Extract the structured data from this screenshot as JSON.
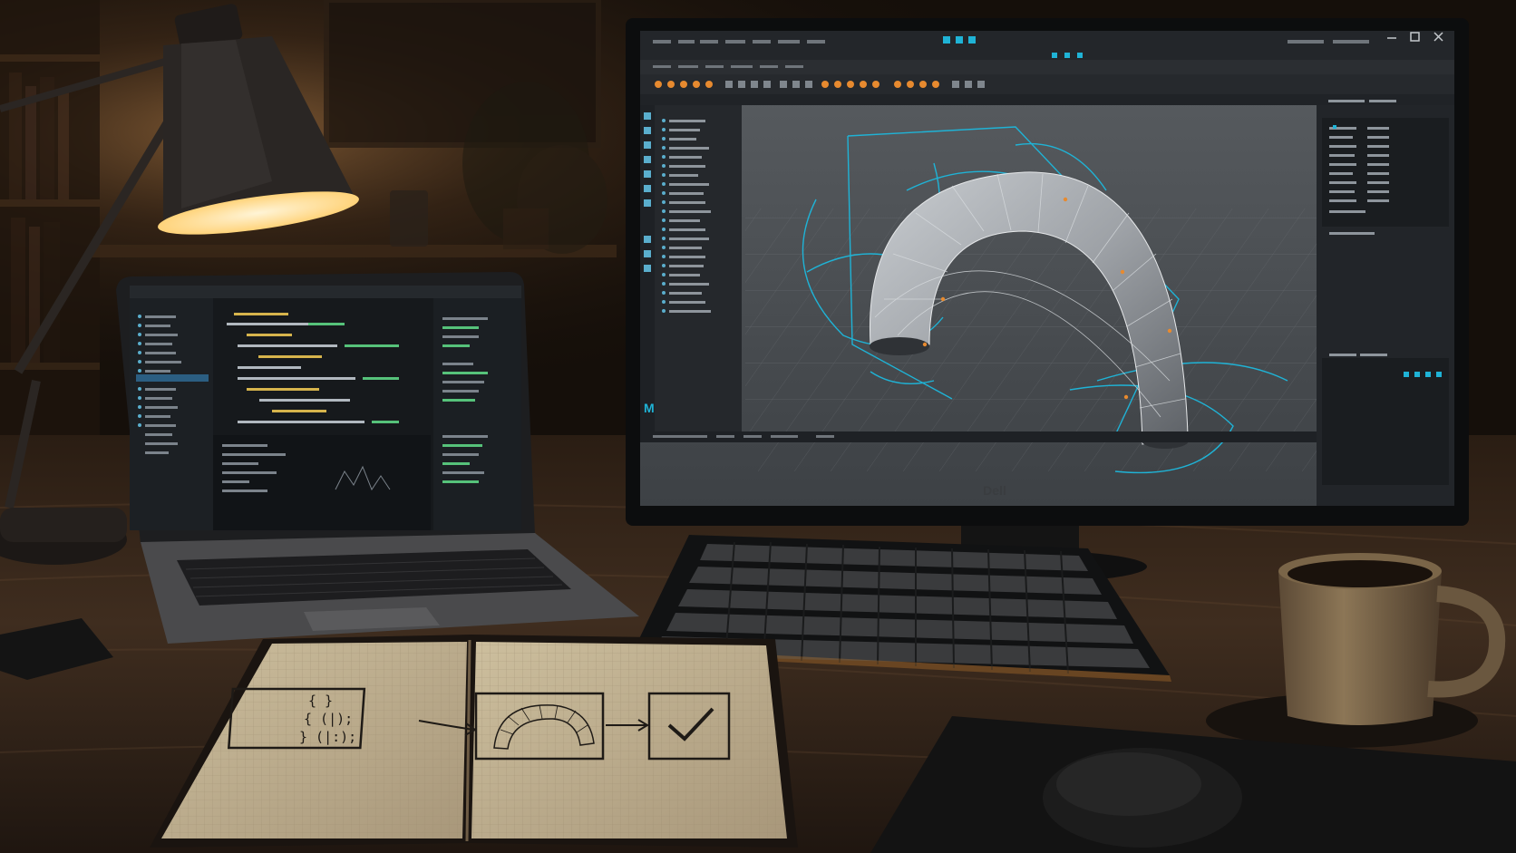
{
  "scene": {
    "description_label": "Desk workspace with monitor, laptop, notebook, keyboard and coffee mug",
    "app_logo_letter": "M",
    "monitor_brand": "Dell",
    "notebook_code_symbols": [
      "{ }",
      "{ (|);",
      "} (|:);"
    ]
  },
  "colors": {
    "wood": "#3a2a1d",
    "screen_dark": "#1d2024",
    "viewport": "#4b4f54",
    "accent_blue": "#1fb3d6",
    "accent_orange": "#e78a2f",
    "paper": "#d8cab3",
    "lamp_light": "#ffe1a3"
  }
}
